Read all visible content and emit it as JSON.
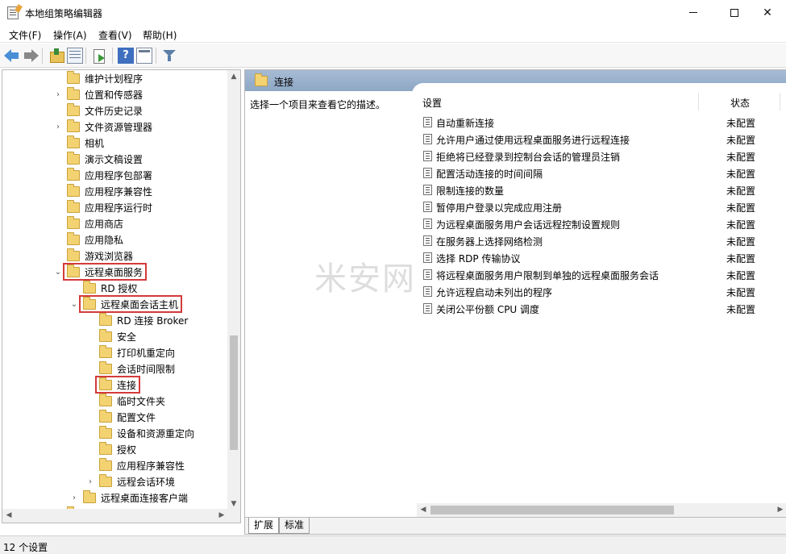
{
  "window": {
    "title": "本地组策略编辑器",
    "minimize": "—",
    "maximize": "□",
    "close": "✕"
  },
  "menu": {
    "items": [
      "文件(F)",
      "操作(A)",
      "查看(V)",
      "帮助(H)"
    ]
  },
  "toolbar": {
    "icons": [
      "back-arrow-icon",
      "forward-arrow-icon",
      "folder-up-icon",
      "show-hide-tree-icon",
      "export-list-icon",
      "help-icon",
      "properties-icon",
      "filter-icon"
    ],
    "help_glyph": "?"
  },
  "tree": {
    "nodes": [
      {
        "label": "维护计划程序",
        "level": 0,
        "expander": ""
      },
      {
        "label": "位置和传感器",
        "level": 0,
        "expander": "›"
      },
      {
        "label": "文件历史记录",
        "level": 0,
        "expander": ""
      },
      {
        "label": "文件资源管理器",
        "level": 0,
        "expander": "›"
      },
      {
        "label": "相机",
        "level": 0,
        "expander": ""
      },
      {
        "label": "演示文稿设置",
        "level": 0,
        "expander": ""
      },
      {
        "label": "应用程序包部署",
        "level": 0,
        "expander": ""
      },
      {
        "label": "应用程序兼容性",
        "level": 0,
        "expander": ""
      },
      {
        "label": "应用程序运行时",
        "level": 0,
        "expander": ""
      },
      {
        "label": "应用商店",
        "level": 0,
        "expander": ""
      },
      {
        "label": "应用隐私",
        "level": 0,
        "expander": ""
      },
      {
        "label": "游戏浏览器",
        "level": 0,
        "expander": ""
      },
      {
        "label": "远程桌面服务",
        "level": 0,
        "expander": "⌄",
        "highlight": true
      },
      {
        "label": "RD 授权",
        "level": 1,
        "expander": ""
      },
      {
        "label": "远程桌面会话主机",
        "level": 1,
        "expander": "⌄",
        "highlight": true
      },
      {
        "label": "RD 连接 Broker",
        "level": 2,
        "expander": ""
      },
      {
        "label": "安全",
        "level": 2,
        "expander": ""
      },
      {
        "label": "打印机重定向",
        "level": 2,
        "expander": ""
      },
      {
        "label": "会话时间限制",
        "level": 2,
        "expander": ""
      },
      {
        "label": "连接",
        "level": 2,
        "expander": "",
        "highlight": true,
        "selected": true
      },
      {
        "label": "临时文件夹",
        "level": 2,
        "expander": ""
      },
      {
        "label": "配置文件",
        "level": 2,
        "expander": ""
      },
      {
        "label": "设备和资源重定向",
        "level": 2,
        "expander": ""
      },
      {
        "label": "授权",
        "level": 2,
        "expander": ""
      },
      {
        "label": "应用程序兼容性",
        "level": 2,
        "expander": ""
      },
      {
        "label": "远程会话环境",
        "level": 2,
        "expander": "›"
      },
      {
        "label": "远程桌面连接客户端",
        "level": 1,
        "expander": "›"
      },
      {
        "label": "云内容",
        "level": 0,
        "expander": ""
      }
    ],
    "scroll_up": "▲",
    "scroll_down": "▼",
    "scroll_left": "◀",
    "scroll_right": "▶"
  },
  "right": {
    "header_title": "连接",
    "description": "选择一个项目来查看它的描述。",
    "columns": {
      "setting": "设置",
      "state": "状态"
    },
    "rows": [
      {
        "name": "自动重新连接",
        "state": "未配置"
      },
      {
        "name": "允许用户通过使用远程桌面服务进行远程连接",
        "state": "未配置"
      },
      {
        "name": "拒绝将已经登录到控制台会话的管理员注销",
        "state": "未配置"
      },
      {
        "name": "配置活动连接的时间间隔",
        "state": "未配置"
      },
      {
        "name": "限制连接的数量",
        "state": "未配置"
      },
      {
        "name": "暂停用户登录以完成应用注册",
        "state": "未配置"
      },
      {
        "name": "为远程桌面服务用户会话远程控制设置规则",
        "state": "未配置"
      },
      {
        "name": "在服务器上选择网络检测",
        "state": "未配置"
      },
      {
        "name": "选择 RDP 传输协议",
        "state": "未配置"
      },
      {
        "name": "将远程桌面服务用户限制到单独的远程桌面服务会话",
        "state": "未配置"
      },
      {
        "name": "允许远程启动未列出的程序",
        "state": "未配置"
      },
      {
        "name": "关闭公平份额 CPU 调度",
        "state": "未配置"
      }
    ],
    "scroll_left": "◀",
    "scroll_right": "▶",
    "tabs": [
      "扩展",
      "标准"
    ]
  },
  "watermark": "米安网",
  "status": {
    "text": "12 个设置"
  }
}
